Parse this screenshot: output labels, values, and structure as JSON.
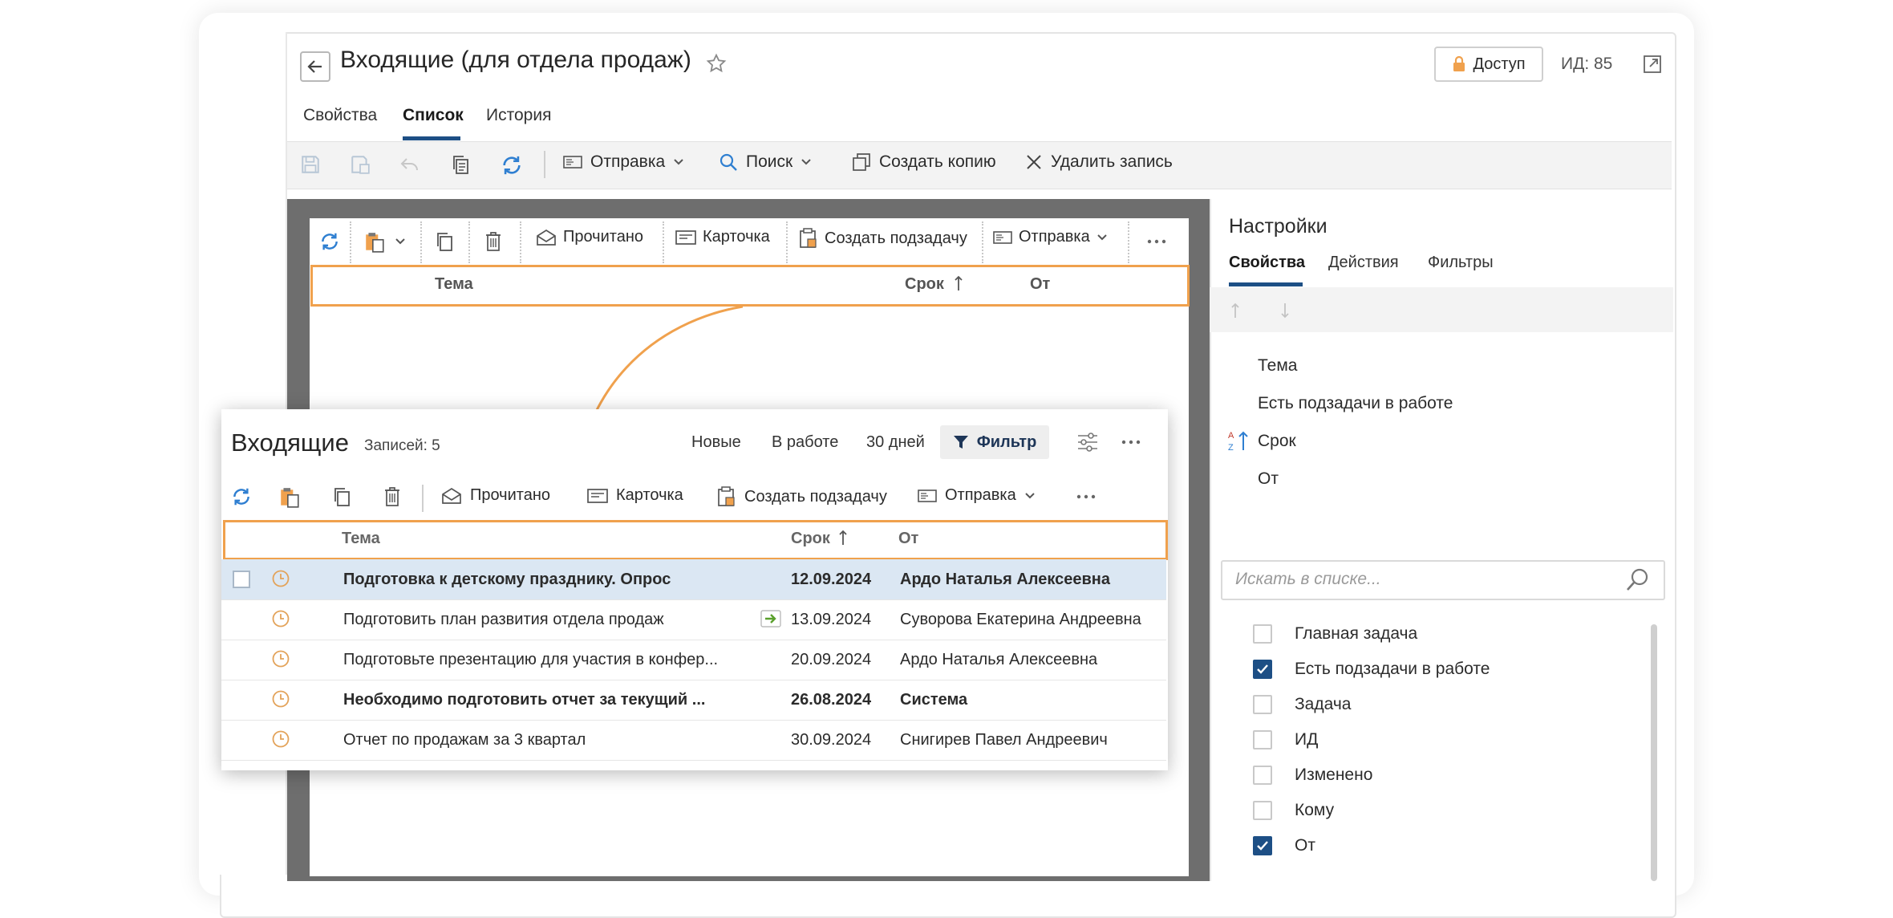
{
  "header": {
    "title": "Входящие (для отдела продаж)",
    "access_label": "Доступ",
    "id_label": "ИД: 85"
  },
  "tabs": [
    "Свойства",
    "Список",
    "История"
  ],
  "toolbar": {
    "send_label": "Отправка",
    "search_label": "Поиск",
    "copy_label": "Создать копию",
    "delete_label": "Удалить запись"
  },
  "preview": {
    "toolbar": {
      "read_label": "Прочитано",
      "card_label": "Карточка",
      "subtask_label": "Создать подзадачу",
      "send_label": "Отправка"
    },
    "columns": {
      "subject": "Тема",
      "due": "Срок",
      "from": "От"
    }
  },
  "settings": {
    "title": "Настройки",
    "tabs": [
      "Свойства",
      "Действия",
      "Фильтры"
    ],
    "sort_fields": [
      "Тема",
      "Есть подзадачи в работе",
      "Срок",
      "От"
    ],
    "search_placeholder": "Искать в списке...",
    "fields": [
      {
        "label": "Главная задача",
        "checked": false
      },
      {
        "label": "Есть подзадачи в работе",
        "checked": true
      },
      {
        "label": "Задача",
        "checked": false
      },
      {
        "label": "ИД",
        "checked": false
      },
      {
        "label": "Изменено",
        "checked": false
      },
      {
        "label": "Кому",
        "checked": false
      },
      {
        "label": "От",
        "checked": true
      }
    ]
  },
  "list": {
    "title": "Входящие",
    "count": "Записей: 5",
    "filters": {
      "new": "Новые",
      "in_work": "В работе",
      "days30": "30 дней",
      "filter": "Фильтр"
    },
    "toolbar": {
      "read_label": "Прочитано",
      "card_label": "Карточка",
      "subtask_label": "Создать подзадачу",
      "send_label": "Отправка"
    },
    "columns": {
      "subject": "Тема",
      "due": "Срок",
      "from": "От"
    },
    "rows": [
      {
        "subject": "Подготовка к детскому празднику. Опрос",
        "due": "12.09.2024",
        "from": "Ардо Наталья Алексеевна",
        "bold": true,
        "selected": true
      },
      {
        "subject": "Подготовить план развития отдела продаж",
        "due": "13.09.2024",
        "from": "Суворова Екатерина Андреевна",
        "bold": false,
        "selected": false
      },
      {
        "subject": "Подготовьте презентацию для участия в конфер...",
        "due": "20.09.2024",
        "from": "Ардо Наталья Алексеевна",
        "bold": false,
        "selected": false
      },
      {
        "subject": "Необходимо подготовить отчет за текущий ...",
        "due": "26.08.2024",
        "from": "Система",
        "bold": true,
        "selected": false
      },
      {
        "subject": "Отчет по продажам за 3 квартал",
        "due": "30.09.2024",
        "from": "Снигирев Павел Андреевич",
        "bold": false,
        "selected": false
      }
    ]
  },
  "colors": {
    "accent": "#1d4f85",
    "highlight": "#f0a14d",
    "selected_row": "#dbe7f3",
    "icon_blue": "#2f7fd1",
    "clock": "#e3a35a"
  },
  "icons": [
    "back-icon",
    "star-icon",
    "lock-icon",
    "open-external-icon",
    "save-icon",
    "undo-icon",
    "refresh-icon",
    "search-icon",
    "filter-icon",
    "clock-icon",
    "forward-arrow-icon"
  ]
}
